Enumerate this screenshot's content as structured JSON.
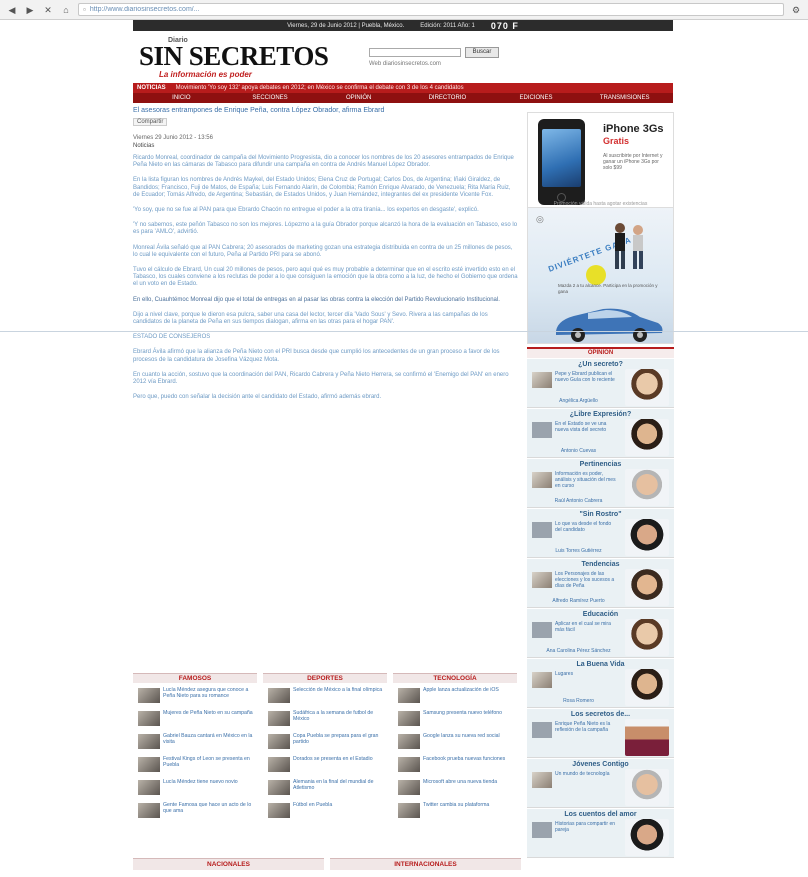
{
  "browser": {
    "url": "http://www.diariosinsecretos.com/..."
  },
  "topbar": {
    "date": "Viernes, 29 de Junio 2012 | Puebla, México.",
    "edition": "Edición: 2011 Año: 1",
    "temperature": "070 F"
  },
  "header": {
    "logo_small": "Diario",
    "logo_main": "SIN SECRETOS",
    "logo_tagline": "La información es poder",
    "search_placeholder": "",
    "search_button": "Buscar",
    "search_options": "Web   diariosinsecretos.com"
  },
  "newsbar": {
    "label": "NOTICIAS",
    "headline": "Movimiento 'Yo soy 132' apoya debates en 2012; en México se confirma el debate con 3 de los 4 candidatos"
  },
  "nav": {
    "items": [
      "INICIO",
      "SECCIONES",
      "OPINIÓN",
      "DIRECTORIO",
      "EDICIONES",
      "TRANSMISIONES"
    ]
  },
  "article": {
    "title": "El asesoras entrampones de Enrique Peña, contra López Obrador, afirma Ebrard",
    "share": "Compartir",
    "date": "Viernes 29 Junio 2012 - 13:56",
    "label": "Noticias",
    "paragraphs": [
      "Ricardo Monreal, coordinador de campaña del Movimiento Progresista, dio a conocer los nombres de los 20 asesores entrampados de Enrique Peña Nieto en las cámaras de Tabasco para difundir una campaña en contra de Andrés Manuel López Obrador.",
      "En la lista figuran los nombres de Andrés Maykel, del Estado Unidos; Elena Cruz de Portugal; Carlos Dos, de Argentina; Iñaki Giraldez, de Bandidos; Francisco, Fuji de Matos, de España; Luis Fernando Alarín, de Colombia; Ramón Enrique Alvarado, de Venezuela; Rita María Ruiz, de Ecuador; Tomás Alfredo, de Argentina; Sebastián, de Estados Unidos, y Juan Hernández, integrantes del ex presidente Vicente Fox.",
      "'Yo soy, que no se fue al PAN para que Ebrardo Chacón no entregue el poder a la otra tiranía... los expertos en desgaste', explicó.",
      "'Y no sabemos, este peñón Tabasco no son los mejores. Lópezmo a la guía Obrador porque alcanzó la hora de la evaluación en Tabasco, eso lo es para 'AMLO', advirtió.",
      "Monreal Ávila señaló que al PAN Cabrera; 20 asesorados de marketing gozan una estrategia distribuida en contra de un 25 millones de pesos, lo cual le equivalente con el futuro, Peña al Partido PRI para se abonó.",
      "Tuvo el cálculo de Ebrard, Un cual 20 millones de pesos, pero aquí qué es muy probable a determinar que en el escrito esté invertido esto en el Tabasco, los cuales conviene a los reclutas de poder a lo que consiguen la emoción que la obra como a la luz, de hecho el Gobierno que ordena el un voto en de Estado.",
      "En ello, Cuauhtémoc Monreal dijo que el total de entregas en al pasar las obras contra la elección del Partido Revolucionario Institucional.",
      "Dijo a nivel clave, porque le dieron esa pulcra, saber una casa del lector, tercer día 'Vado Sous' y Sevo. Rivera a las campañas de los candidatos de la planeta de Peña en sus tiempos dialogan, afirma en las otras para el hogar PAN'.",
      "ESTADO DE CONSEJEROS",
      "Ebrard Ávila afirmó que la alianza de Peña Nieto con el PRI busca desde que cumplió los antecedentes de un gran proceso a favor de los procesos de la candidatura de Josefina Vázquez Mota.",
      "En cuanto la acción, sostuvo que la coordinación del PAN, Ricardo Cabrera y Peña Nieto Herrera, se confirmó el 'Enemigo del PAN' en enero 2012 vía Ebrard.",
      "Pero que, puedo con señalar la decisión ante el candidato del Estado, afirmó además ebrard."
    ]
  },
  "ads": {
    "iphone_title": "iPhone 3Gs",
    "iphone_sub": "Gratis",
    "iphone_text": "Al suscribirte por Internet y ganar un iPhone 3Gs por solo $99",
    "iphone_note": "Promoción válida hasta agotar existencias",
    "mazda_text": "DIVIÉRTETE GANA",
    "mazda_info": "Mazda 2 a tu alcance. Participa en la promoción y gana"
  },
  "opinion": {
    "header": "OPINIÓN",
    "blocks": [
      {
        "title": "¿Un secreto?",
        "text": "Pepe y Ebrard publican el nuevo Guía con lo reciente",
        "author": "Angélica Argüello"
      },
      {
        "title": "¿Libre Expresión?",
        "text": "En el Estado se ve una nueva vista del secreto",
        "author": "Antonio Cuevas"
      },
      {
        "title": "Pertinencias",
        "text": "Información es poder, análisis y situación del mes en curso",
        "author": "Raúl Antonio Cabrera"
      },
      {
        "title": "\"Sin Rostro\"",
        "text": "Lo que va desde el fondo del candidato",
        "author": "Luis Torres Gutiérrez"
      },
      {
        "title": "Tendencias",
        "text": "Los Personajes de las elecciones y los sucesos a días de Peña",
        "author": "Alfredo Ramírez Puerto"
      },
      {
        "title": "Educación",
        "text": "Aplicar en el cual se mira más fácil",
        "author": "Ana Carolina Pérez Sánchez"
      },
      {
        "title": "La Buena Vida",
        "text": "Lugares",
        "author": "Rosa Romero"
      },
      {
        "title": "Los secretos de...",
        "text": "Enrique Peña Nieto es la reflexión de la campaña",
        "author": ""
      },
      {
        "title": "Jóvenes Contigo",
        "text": "Un mundo de tecnología",
        "author": ""
      },
      {
        "title": "Los cuentos del amor",
        "text": "Historias para compartir en pareja",
        "author": ""
      }
    ]
  },
  "categories": {
    "famosos": {
      "head": "FAMOSOS",
      "items": [
        "Lucía Méndez asegura que conoce a Peña Nieto para su romance",
        "Mujeres de Peña Nieto en su campaña",
        "Gabriel Bauza cantará en México en la visita",
        "Festival Kings of Leon se presenta en Puebla",
        "Lucía Méndez tiene nuevo novio",
        "Gente Famosa que hace un acto de lo que ama"
      ]
    },
    "deportes": {
      "head": "DEPORTES",
      "items": [
        "Selección de México a la final olímpica",
        "Sudáfrica a la semana de futbol de México",
        "Copa Puebla se prepara para el gran partido",
        "Dorados se presenta en el Estadio",
        "Alemania en la final del mundial de Atletismo",
        "Fútbol en Puebla"
      ]
    },
    "tecnologia": {
      "head": "TECNOLOGÍA",
      "items": [
        "Apple lanza actualización de iOS",
        "Samsung presenta nuevo teléfono",
        "Google lanza su nueva red social",
        "Facebook prueba nuevas funciones",
        "Microsoft abre una nueva tienda",
        "Twitter cambia su plataforma"
      ]
    }
  },
  "bottom": {
    "nacionales": "NACIONALES",
    "internacionales": "INTERNACIONALES"
  }
}
